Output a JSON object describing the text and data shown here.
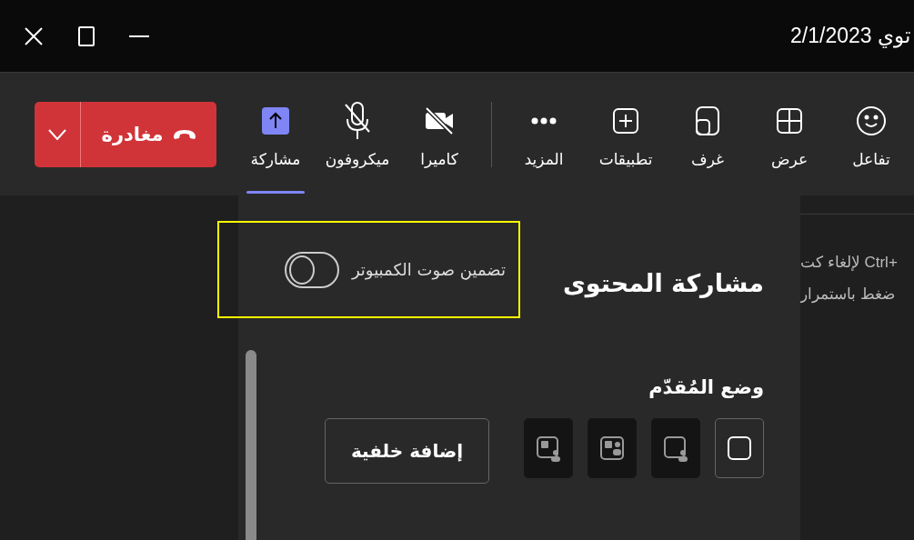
{
  "window": {
    "title": "توي 2/1/2023"
  },
  "toolbar": {
    "items": [
      {
        "kind": "react",
        "label": "تفاعل",
        "selected": false
      },
      {
        "kind": "view",
        "label": "عرض",
        "selected": false
      },
      {
        "kind": "rooms",
        "label": "غرف",
        "selected": false
      },
      {
        "kind": "apps",
        "label": "تطبيقات",
        "selected": false
      },
      {
        "kind": "more",
        "label": "المزيد",
        "selected": false
      },
      {
        "kind": "camera",
        "label": "كاميرا",
        "selected": false
      },
      {
        "kind": "mic",
        "label": "ميكروفون",
        "selected": false
      },
      {
        "kind": "share",
        "label": "مشاركة",
        "selected": true
      }
    ],
    "leave_button": {
      "label": "مغادرة"
    }
  },
  "share_panel": {
    "title": "مشاركة المحتوى",
    "include_audio": {
      "label": "تضمين صوت الكمبيوتر",
      "on": false
    },
    "presenter_mode": {
      "label": "وضع المُقدّم",
      "modes": [
        {
          "kind": "content",
          "selected": true
        },
        {
          "kind": "standout",
          "selected": false
        },
        {
          "kind": "side",
          "selected": false
        },
        {
          "kind": "reporter",
          "selected": false
        }
      ]
    },
    "background_button": "إضافة خلفية"
  },
  "side_text": [
    "لإلغاء كت Ctrl+",
    "ضغط باستمرار"
  ]
}
